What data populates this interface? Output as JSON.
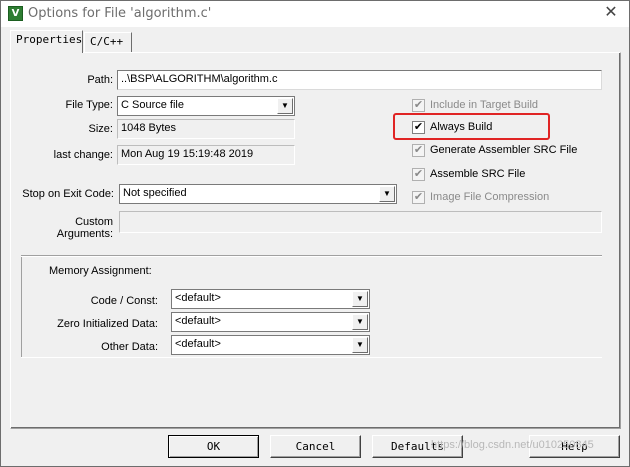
{
  "window": {
    "title": "Options for File 'algorithm.c'",
    "close_glyph": "✕",
    "app_icon_letter": "V"
  },
  "tabs": [
    {
      "label": "Properties",
      "active": true
    },
    {
      "label": "C/C++",
      "active": false
    }
  ],
  "properties": {
    "path_label": "Path:",
    "path_value": "..\\BSP\\ALGORITHM\\algorithm.c",
    "file_type_label": "File Type:",
    "file_type_value": "C Source file",
    "size_label": "Size:",
    "size_value": "1048 Bytes",
    "last_change_label": "last change:",
    "last_change_value": "Mon Aug 19 15:19:48 2019",
    "stop_on_exit_label": "Stop on Exit Code:",
    "stop_on_exit_value": "Not specified",
    "custom_args_label": "Custom Arguments:",
    "custom_args_value": ""
  },
  "options": [
    {
      "label": "Include in Target Build",
      "checked": true,
      "enabled": false
    },
    {
      "label": "Always Build",
      "checked": true,
      "enabled": true
    },
    {
      "label": "Generate Assembler SRC File",
      "checked": true,
      "enabled": false
    },
    {
      "label": "Assemble SRC File",
      "checked": true,
      "enabled": false
    },
    {
      "label": "Image File Compression",
      "checked": true,
      "enabled": false
    }
  ],
  "memory": {
    "title": "Memory Assignment:",
    "code_const_label": "Code / Const:",
    "code_const_value": "<default>",
    "zero_init_label": "Zero Initialized Data:",
    "zero_init_value": "<default>",
    "other_label": "Other Data:",
    "other_value": "<default>"
  },
  "buttons": {
    "ok": "OK",
    "cancel": "Cancel",
    "defaults": "Defaults",
    "help": "Help"
  },
  "watermark": "https://blog.csdn.net/u010250845",
  "colors": {
    "highlight": "#e02424",
    "dialog_bg": "#f0f0f0"
  },
  "check_glyph": "✔",
  "dropdown_glyph": "▼"
}
